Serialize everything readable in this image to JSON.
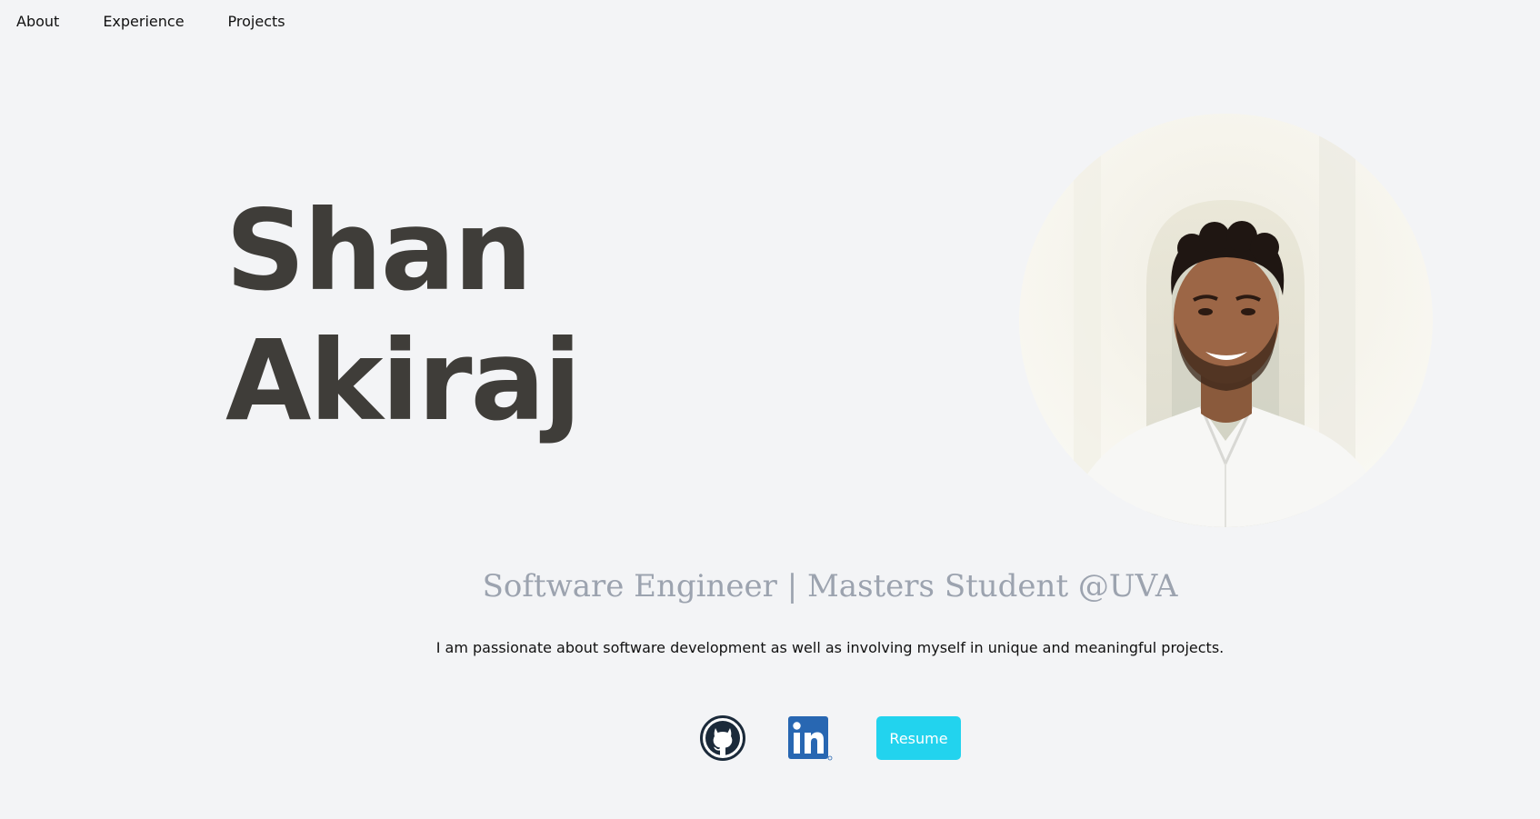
{
  "nav": {
    "items": [
      {
        "label": "About"
      },
      {
        "label": "Experience"
      },
      {
        "label": "Projects"
      }
    ]
  },
  "hero": {
    "first_name": "Shan",
    "last_name": "Akiraj",
    "subtitle": "Software Engineer | Masters Student @UVA",
    "tagline": "I am passionate about software development as well as involving myself in unique and meaningful projects."
  },
  "socials": {
    "github_icon": "github-icon",
    "linkedin_icon": "linkedin-icon",
    "resume_label": "Resume"
  },
  "colors": {
    "background": "#f3f4f6",
    "name_text": "#3f3d39",
    "subtitle_text": "#9ca3af",
    "resume_button": "#22d3ee",
    "github": "#1b2a3a",
    "linkedin": "#2867b2"
  }
}
